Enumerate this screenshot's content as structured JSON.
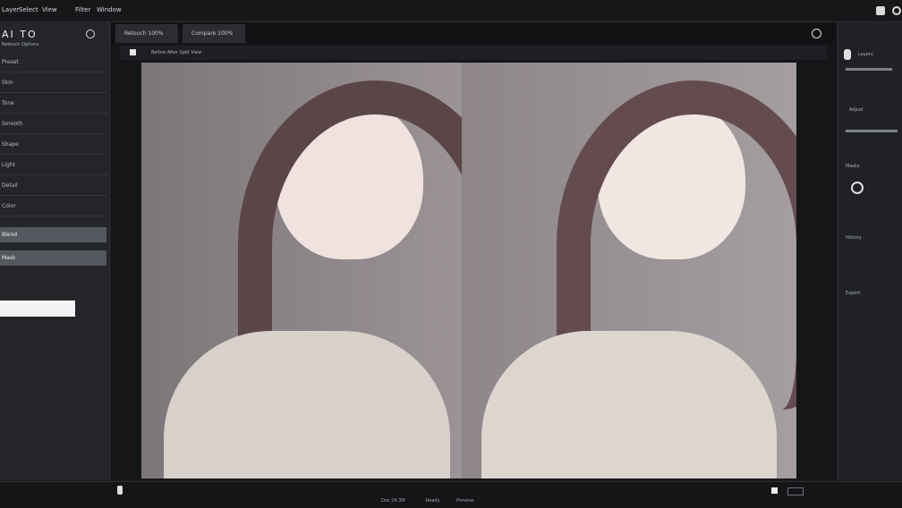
{
  "topbar": {
    "menu": [
      "Layer",
      "Select",
      "View",
      "Filter",
      "Window"
    ],
    "icons": [
      "square-icon",
      "circle-icon"
    ]
  },
  "left_panel": {
    "title": "AI TO",
    "subtitle": "Retouch Options",
    "rows": [
      "Preset",
      "Skin",
      "Tone",
      "Smooth",
      "Shape",
      "Light",
      "Detail",
      "Color"
    ],
    "selected_rows": [
      "Blend",
      "Mask"
    ],
    "input_value": ""
  },
  "tabs": [
    "Retouch 100%",
    "Compare 100%"
  ],
  "viewer": {
    "toolbar_text": "Before After Split View"
  },
  "right_panel": {
    "items": [
      "Layers",
      "Adjust",
      "Masks",
      "History",
      "Export"
    ]
  },
  "status": {
    "left": "Doc 24.3M",
    "center": "Ready",
    "right": "Preview"
  }
}
